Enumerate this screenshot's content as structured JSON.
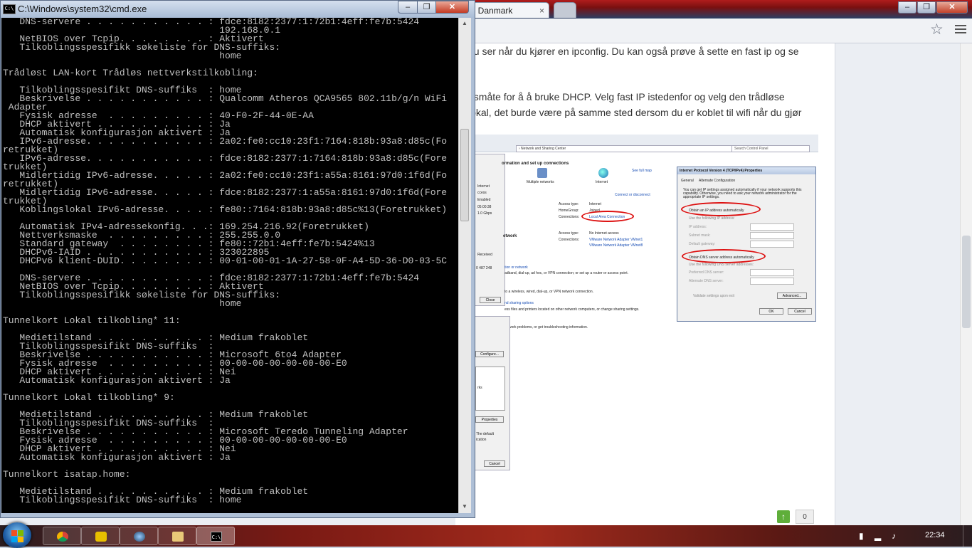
{
  "browser": {
    "tab_title": "otel Danmark",
    "tab_close": "×",
    "window_controls": {
      "minimize": "–",
      "maximize": "❐",
      "close": "✕"
    },
    "star_icon": "☆",
    "post_lines": [
      "du ser når du kjører en ipconfig. Du kan også prøve å sette en fast ip og se",
      "gsmåte for å å bruke DHCP. Velg fast IP istedenfor og velg den trådløse",
      "lokal, det burde være på samme sted dersom du er koblet til wifi når du gjør"
    ],
    "upvote_icon": "↑",
    "vote_count": "0"
  },
  "screenshot": {
    "address": "› Network and Sharing Center",
    "search_placeholder": "Search Control Panel",
    "heading": "ormation and set up connections",
    "see_full_map": "See full map",
    "node_multiple": "Multiple networks",
    "node_internet": "Internet",
    "connect_disconnect": "Connect or disconnect",
    "access_type_label": "Access type:",
    "access_type_value": "Internet",
    "homegroup_label": "HomeGroup:",
    "homegroup_value": "Joined",
    "connections_label": "Connections:",
    "connection_lan": "Local Area Connection",
    "network_label": "etwork",
    "access_type_value2": "No Internet access",
    "vmnet1": "VMware Network Adapter VMnet1",
    "vmnet8": "VMware Network Adapter VMnet8",
    "side_lines": [
      "Internet",
      "ccess",
      "Enabled",
      "05:00:38",
      "1.0 Gbps"
    ],
    "side_received": "Received",
    "side_bytes": "0 487 248",
    "close_btn": "Close",
    "task1": "tion or network",
    "task1b": "adband, dial-up, ad hoc, or VPN connection; or set up a router or access point.",
    "task2": "to a wireless, wired, dial-up, or VPN network connection.",
    "task3": "nd sharing options",
    "task3b": "ess files and printers located on other network computers, or change sharing settings.",
    "task4": "work problems, or get troubleshooting information.",
    "configure_btn": "Configure...",
    "side2_works": "rks",
    "properties_btn": "Properties",
    "side2_default": "The default",
    "side2_ication": "ication",
    "cancel_btn2": "Cancel",
    "ipv4": {
      "title": "Internet Protocol Version 4 (TCP/IPv4) Properties",
      "tab_general": "General",
      "tab_alternate": "Alternate Configuration",
      "intro": "You can get IP settings assigned automatically if your network supports this capability. Otherwise, you need to ask your network administrator for the appropriate IP settings.",
      "obtain_ip": "Obtain an IP address automatically",
      "use_following_ip": "Use the following IP address:",
      "ip_address": "IP address:",
      "subnet_mask": "Subnet mask:",
      "default_gateway": "Default gateway:",
      "obtain_dns": "Obtain DNS server address automatically",
      "use_following_dns": "Use the following DNS server addresses:",
      "preferred_dns": "Preferred DNS server:",
      "alternate_dns": "Alternate DNS server:",
      "validate": "Validate settings upon exit",
      "advanced": "Advanced...",
      "ok": "OK",
      "cancel": "Cancel"
    }
  },
  "cmd": {
    "title": "C:\\Windows\\system32\\cmd.exe",
    "icon_text": "C:\\",
    "controls": {
      "minimize": "–",
      "maximize": "❐",
      "close": "✕"
    },
    "scroll_up": "▲",
    "scroll_down": "▼",
    "output": "   DNS-servere . . . . . . . . . . . : fdce:8182:2377:1:72b1:4eff:fe7b:5424\n                                       192.168.0.1\n   NetBIOS over Tcpip. . . . . . . . : Aktivert\n   Tilkoblingsspesifikk søkeliste for DNS-suffiks:\n                                       home\n\nTrådløst LAN-kort Trådløs nettverkstilkobling:\n\n   Tilkoblingsspesifikt DNS-suffiks  : home\n   Beskrivelse . . . . . . . . . . . : Qualcomm Atheros QCA9565 802.11b/g/n WiFi\n Adapter\n   Fysisk adresse  . . . . . . . . . : 40-F0-2F-44-0E-AA\n   DHCP aktivert . . . . . . . . . . : Ja\n   Automatisk konfigurasjon aktivert : Ja\n   IPv6-adresse. . . . . . . . . . . : 2a02:fe0:cc10:23f1:7164:818b:93a8:d85c(Fo\nretrukket)\n   IPv6-adresse. . . . . . . . . . . : fdce:8182:2377:1:7164:818b:93a8:d85c(Fore\ntrukket)\n   Midlertidig IPv6-adresse. . . . . : 2a02:fe0:cc10:23f1:a55a:8161:97d0:1f6d(Fo\nretrukket)\n   Midlertidig IPv6-adresse. . . . . : fdce:8182:2377:1:a55a:8161:97d0:1f6d(Fore\ntrukket)\n   Koblingslokal IPv6-adresse. . . . : fe80::7164:818b:93a8:d85c%13(Foretrukket)\n\n   Automatisk IPv4-adressekonfig. . .: 169.254.216.92(Foretrukket)\n   Nettverksmaske  . . . . . . . . . : 255.255.0.0\n   Standard gateway  . . . . . . . . : fe80::72b1:4eff:fe7b:5424%13\n   DHCPv6-IAID . . . . . . . . . . . : 323022895\n   DHCPv6 klient-DUID. . . . . . . . : 00-01-00-01-1A-27-58-0F-A4-5D-36-D0-03-5C\n\n   DNS-servere . . . . . . . . . . . : fdce:8182:2377:1:72b1:4eff:fe7b:5424\n   NetBIOS over Tcpip. . . . . . . . : Aktivert\n   Tilkoblingsspesifikk søkeliste for DNS-suffiks:\n                                       home\n\nTunnelkort Lokal tilkobling* 11:\n\n   Medietilstand . . . . . . . . . . : Medium frakoblet\n   Tilkoblingsspesifikt DNS-suffiks  :\n   Beskrivelse . . . . . . . . . . . : Microsoft 6to4 Adapter\n   Fysisk adresse  . . . . . . . . . : 00-00-00-00-00-00-00-E0\n   DHCP aktivert . . . . . . . . . . : Nei\n   Automatisk konfigurasjon aktivert : Ja\n\nTunnelkort Lokal tilkobling* 9:\n\n   Medietilstand . . . . . . . . . . : Medium frakoblet\n   Tilkoblingsspesifikt DNS-suffiks  :\n   Beskrivelse . . . . . . . . . . . : Microsoft Teredo Tunneling Adapter\n   Fysisk adresse  . . . . . . . . . : 00-00-00-00-00-00-00-E0\n   DHCP aktivert . . . . . . . . . . : Nei\n   Automatisk konfigurasjon aktivert : Ja\n\nTunnelkort isatap.home:\n\n   Medietilstand . . . . . . . . . . : Medium frakoblet\n   Tilkoblingsspesifikt DNS-suffiks  : home"
  },
  "taskbar": {
    "icons": [
      "chrome-icon",
      "app-icon",
      "media-icon",
      "folder-icon",
      "cmd-icon"
    ],
    "cmd_icon_text": "C:\\",
    "tray": {
      "battery": "▮",
      "signal": "▂",
      "volume": "♪"
    },
    "clock": "22:34"
  }
}
